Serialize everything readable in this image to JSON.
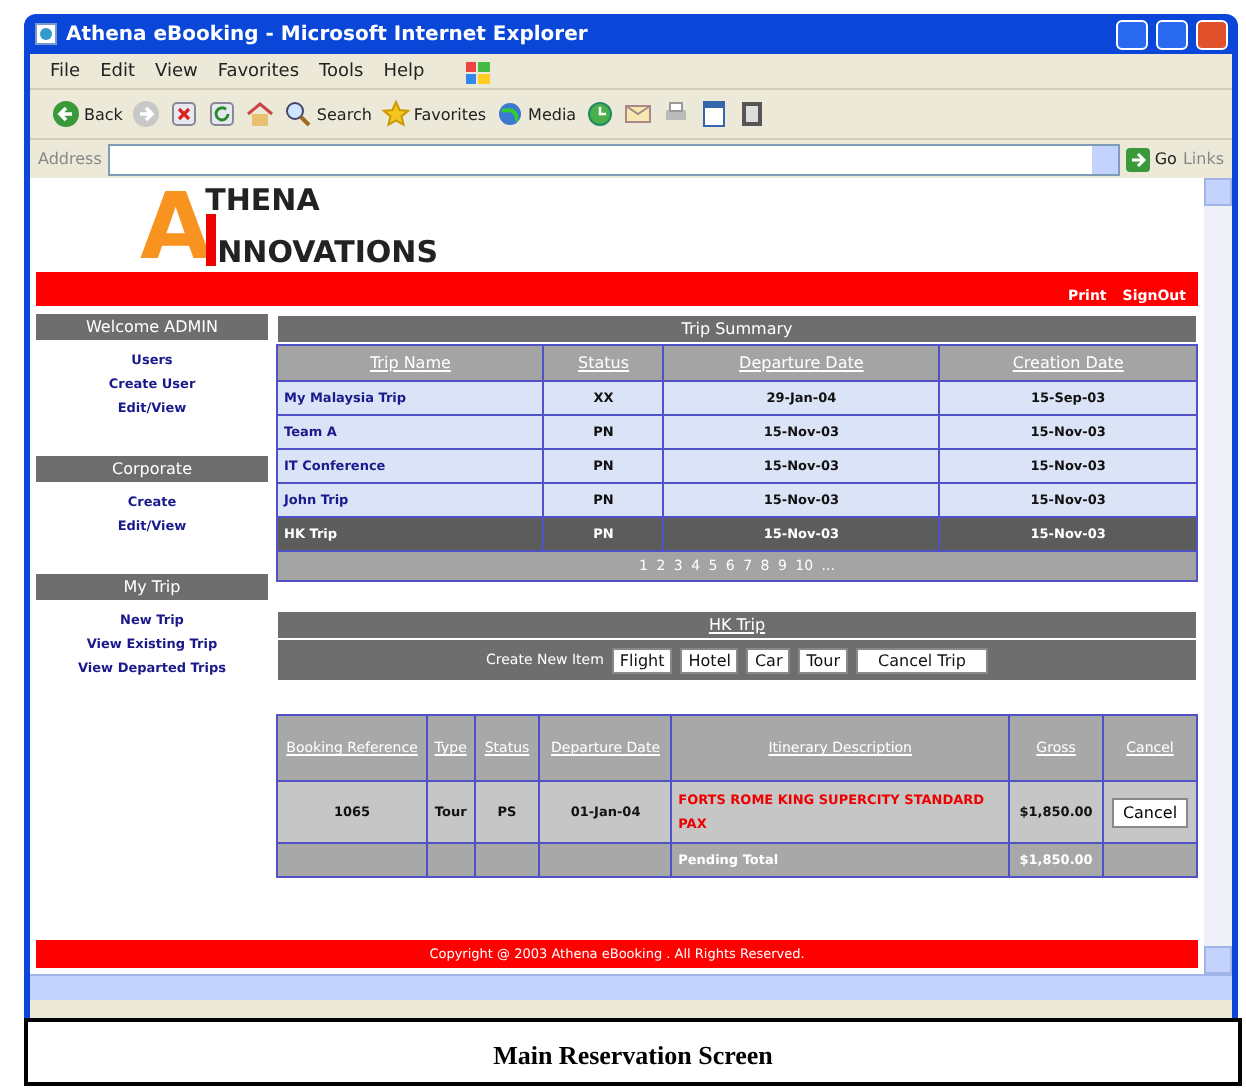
{
  "window": {
    "title": "Athena eBooking - Microsoft Internet Explorer"
  },
  "menu": [
    "File",
    "Edit",
    "View",
    "Favorites",
    "Tools",
    "Help"
  ],
  "toolbar": [
    {
      "kind": "back",
      "label": "Back"
    },
    {
      "kind": "forward"
    },
    {
      "kind": "stop"
    },
    {
      "kind": "refresh"
    },
    {
      "kind": "home"
    },
    {
      "kind": "search",
      "label": "Search"
    },
    {
      "kind": "favorites",
      "label": "Favorites"
    },
    {
      "kind": "media",
      "label": "Media"
    },
    {
      "kind": "history"
    },
    {
      "kind": "mail"
    },
    {
      "kind": "print"
    },
    {
      "kind": "edit"
    },
    {
      "kind": "discuss"
    }
  ],
  "address_bar": {
    "label": "Address",
    "go": "Go",
    "links": "Links"
  },
  "logo": {
    "initial": "A",
    "line1": "THENA",
    "line2": "NNOVATIONS"
  },
  "top_links": [
    "Print",
    "SignOut"
  ],
  "sidebar": [
    {
      "title": "Welcome ADMIN",
      "items": [
        "Users",
        "Create User",
        "Edit/View"
      ]
    },
    {
      "title": "Corporate",
      "items": [
        "Create",
        "Edit/View"
      ]
    },
    {
      "title": "My Trip",
      "items": [
        "New Trip",
        "View Existing Trip",
        "View Departed Trips"
      ]
    }
  ],
  "trip_summary": {
    "title": "Trip Summary",
    "columns": [
      "Trip Name",
      "Status",
      "Departure Date",
      "Creation Date"
    ],
    "rows": [
      {
        "cells": [
          "My Malaysia Trip",
          "XX",
          "29-Jan-04",
          "15-Sep-03"
        ],
        "selected": false
      },
      {
        "cells": [
          "Team A",
          "PN",
          "15-Nov-03",
          "15-Nov-03"
        ],
        "selected": false
      },
      {
        "cells": [
          "IT Conference",
          "PN",
          "15-Nov-03",
          "15-Nov-03"
        ],
        "selected": false
      },
      {
        "cells": [
          "John Trip",
          "PN",
          "15-Nov-03",
          "15-Nov-03"
        ],
        "selected": false
      },
      {
        "cells": [
          "HK Trip",
          "PN",
          "15-Nov-03",
          "15-Nov-03"
        ],
        "selected": true
      }
    ],
    "pagination": "1 2 3 4 5 6 7 8 9 10 ..."
  },
  "trip": {
    "title": "HK Trip",
    "create_label": "Create New Item",
    "buttons": [
      "Flight",
      "Hotel",
      "Car",
      "Tour",
      "Cancel Trip"
    ]
  },
  "bookings": {
    "columns": [
      "Booking Reference",
      "Type",
      "Status",
      "Departure Date",
      "Itinerary Description",
      "Gross",
      "Cancel"
    ],
    "rows": [
      {
        "reference": "1065",
        "type": "Tour",
        "status": "PS",
        "departure": "01-Jan-04",
        "description": "FORTS ROME KING SUPERCITY STANDARD PAX",
        "gross": "$1,850.00",
        "action": "Cancel"
      }
    ],
    "total": {
      "label": "Pending Total",
      "value": "$1,850.00"
    }
  },
  "footer": "Copyright @ 2003 Athena eBooking . All Rights Reserved.",
  "caption": "Main Reservation Screen"
}
